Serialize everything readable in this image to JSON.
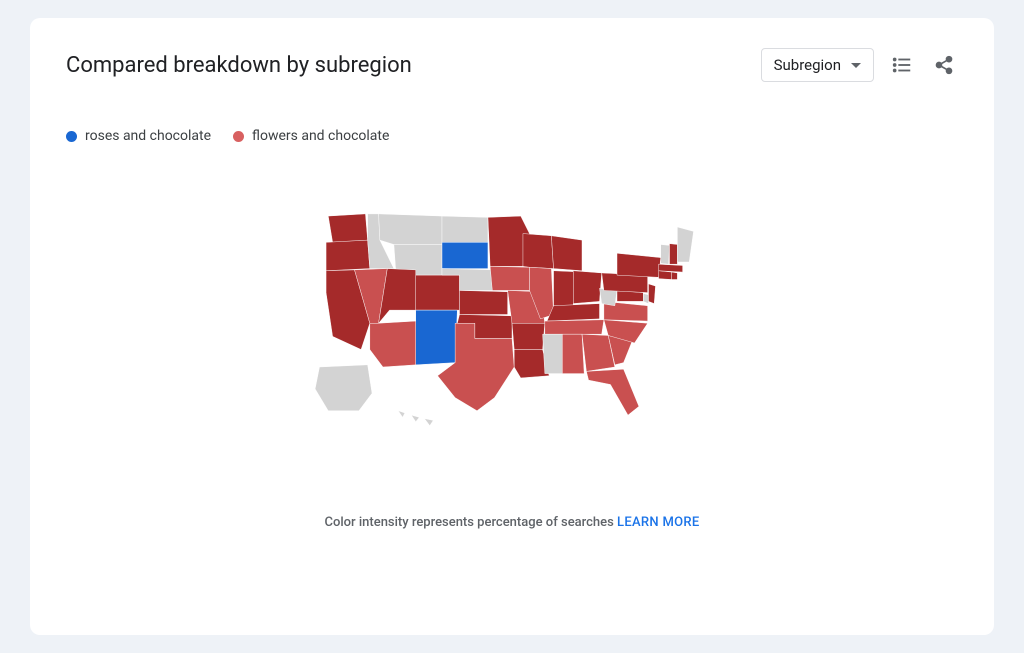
{
  "header": {
    "title": "Compared breakdown by subregion",
    "dropdown_label": "Subregion"
  },
  "legend": {
    "series": [
      {
        "label": "roses and chocolate",
        "color": "#1967d2"
      },
      {
        "label": "flowers and chocolate",
        "color": "#d86060"
      }
    ]
  },
  "footnote": {
    "text": "Color intensity represents percentage of searches ",
    "link_label": "LEARN MORE"
  },
  "chart_data": {
    "type": "choropleth-map",
    "region": "United States (subregion = state)",
    "title": "Compared breakdown by subregion",
    "series_compared": [
      "roses and chocolate",
      "flowers and chocolate"
    ],
    "color_meaning": "Hue indicates which term dominates; intensity indicates relative search share",
    "palette": {
      "roses_and_chocolate": "#1967d2",
      "flowers_and_chocolate_high": "#a52a2a",
      "flowers_and_chocolate_mid": "#c95050",
      "no_data": "#d3d3d3"
    },
    "states": [
      {
        "state": "Washington",
        "dominant": "flowers and chocolate",
        "intensity": "high"
      },
      {
        "state": "Oregon",
        "dominant": "flowers and chocolate",
        "intensity": "high"
      },
      {
        "state": "California",
        "dominant": "flowers and chocolate",
        "intensity": "high"
      },
      {
        "state": "Idaho",
        "dominant": "no data",
        "intensity": null
      },
      {
        "state": "Nevada",
        "dominant": "flowers and chocolate",
        "intensity": "mid"
      },
      {
        "state": "Montana",
        "dominant": "no data",
        "intensity": null
      },
      {
        "state": "Wyoming",
        "dominant": "no data",
        "intensity": null
      },
      {
        "state": "Utah",
        "dominant": "flowers and chocolate",
        "intensity": "high"
      },
      {
        "state": "Arizona",
        "dominant": "flowers and chocolate",
        "intensity": "mid"
      },
      {
        "state": "Colorado",
        "dominant": "flowers and chocolate",
        "intensity": "high"
      },
      {
        "state": "New Mexico",
        "dominant": "roses and chocolate",
        "intensity": "high"
      },
      {
        "state": "North Dakota",
        "dominant": "no data",
        "intensity": null
      },
      {
        "state": "South Dakota",
        "dominant": "roses and chocolate",
        "intensity": "high"
      },
      {
        "state": "Nebraska",
        "dominant": "no data",
        "intensity": null
      },
      {
        "state": "Kansas",
        "dominant": "flowers and chocolate",
        "intensity": "high"
      },
      {
        "state": "Oklahoma",
        "dominant": "flowers and chocolate",
        "intensity": "high"
      },
      {
        "state": "Texas",
        "dominant": "flowers and chocolate",
        "intensity": "mid"
      },
      {
        "state": "Minnesota",
        "dominant": "flowers and chocolate",
        "intensity": "high"
      },
      {
        "state": "Iowa",
        "dominant": "flowers and chocolate",
        "intensity": "mid"
      },
      {
        "state": "Missouri",
        "dominant": "flowers and chocolate",
        "intensity": "mid"
      },
      {
        "state": "Arkansas",
        "dominant": "flowers and chocolate",
        "intensity": "high"
      },
      {
        "state": "Louisiana",
        "dominant": "flowers and chocolate",
        "intensity": "high"
      },
      {
        "state": "Wisconsin",
        "dominant": "flowers and chocolate",
        "intensity": "high"
      },
      {
        "state": "Illinois",
        "dominant": "flowers and chocolate",
        "intensity": "mid"
      },
      {
        "state": "Michigan",
        "dominant": "flowers and chocolate",
        "intensity": "high"
      },
      {
        "state": "Indiana",
        "dominant": "flowers and chocolate",
        "intensity": "high"
      },
      {
        "state": "Ohio",
        "dominant": "flowers and chocolate",
        "intensity": "high"
      },
      {
        "state": "Kentucky",
        "dominant": "flowers and chocolate",
        "intensity": "high"
      },
      {
        "state": "Tennessee",
        "dominant": "flowers and chocolate",
        "intensity": "mid"
      },
      {
        "state": "Mississippi",
        "dominant": "no data",
        "intensity": null
      },
      {
        "state": "Alabama",
        "dominant": "flowers and chocolate",
        "intensity": "mid"
      },
      {
        "state": "Georgia",
        "dominant": "flowers and chocolate",
        "intensity": "mid"
      },
      {
        "state": "Florida",
        "dominant": "flowers and chocolate",
        "intensity": "mid"
      },
      {
        "state": "South Carolina",
        "dominant": "flowers and chocolate",
        "intensity": "mid"
      },
      {
        "state": "North Carolina",
        "dominant": "flowers and chocolate",
        "intensity": "mid"
      },
      {
        "state": "Virginia",
        "dominant": "flowers and chocolate",
        "intensity": "mid"
      },
      {
        "state": "West Virginia",
        "dominant": "no data",
        "intensity": null
      },
      {
        "state": "Maryland",
        "dominant": "flowers and chocolate",
        "intensity": "high"
      },
      {
        "state": "Delaware",
        "dominant": "no data",
        "intensity": null
      },
      {
        "state": "Pennsylvania",
        "dominant": "flowers and chocolate",
        "intensity": "high"
      },
      {
        "state": "New Jersey",
        "dominant": "flowers and chocolate",
        "intensity": "high"
      },
      {
        "state": "New York",
        "dominant": "flowers and chocolate",
        "intensity": "high"
      },
      {
        "state": "Connecticut",
        "dominant": "flowers and chocolate",
        "intensity": "high"
      },
      {
        "state": "Rhode Island",
        "dominant": "flowers and chocolate",
        "intensity": "high"
      },
      {
        "state": "Massachusetts",
        "dominant": "flowers and chocolate",
        "intensity": "high"
      },
      {
        "state": "Vermont",
        "dominant": "no data",
        "intensity": null
      },
      {
        "state": "New Hampshire",
        "dominant": "flowers and chocolate",
        "intensity": "high"
      },
      {
        "state": "Maine",
        "dominant": "no data",
        "intensity": null
      },
      {
        "state": "Alaska",
        "dominant": "no data",
        "intensity": null
      },
      {
        "state": "Hawaii",
        "dominant": "no data",
        "intensity": null
      }
    ]
  }
}
